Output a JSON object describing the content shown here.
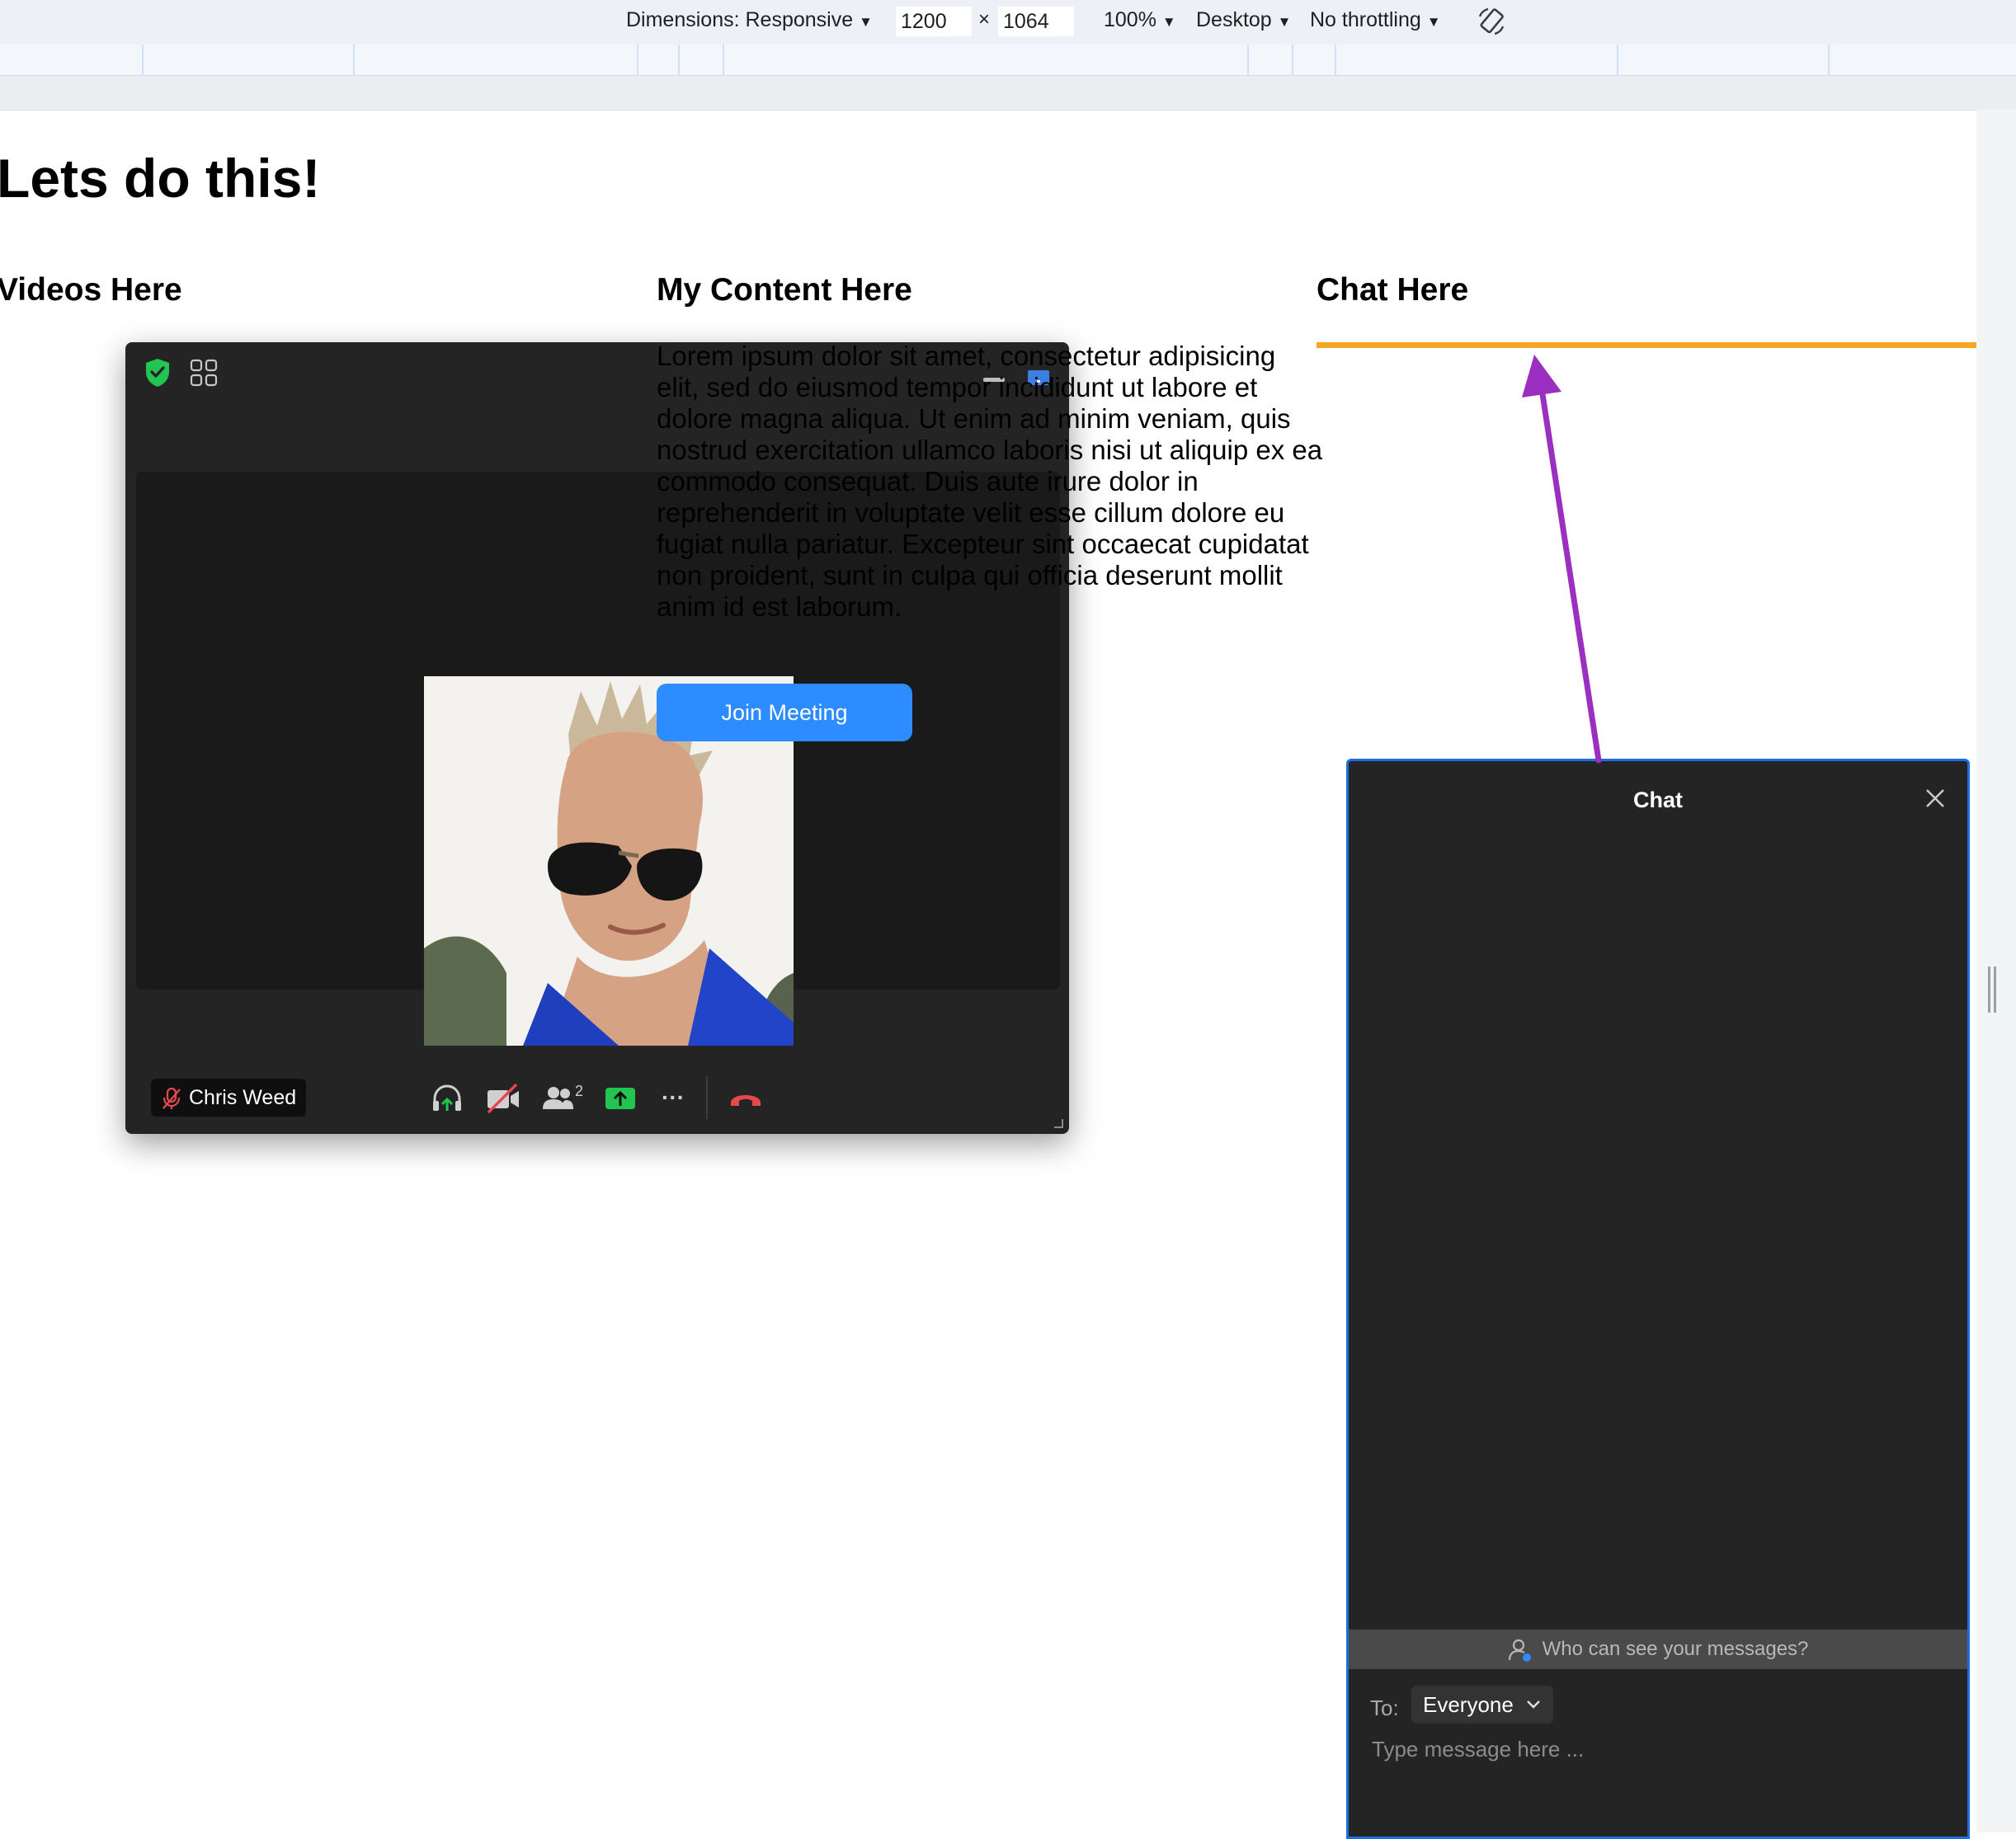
{
  "devtools": {
    "dimensions_label": "Dimensions: Responsive",
    "width_value": "1200",
    "times": "×",
    "height_value": "1064",
    "zoom": "100%",
    "device": "Desktop",
    "throttling": "No throttling",
    "caret": "▼"
  },
  "page": {
    "title": "Lets do this!",
    "col_videos": "Videos Here",
    "col_content": "My Content Here",
    "col_chat": "Chat Here",
    "lorem": "Lorem ipsum dolor sit amet, consectetur adipisicing elit, sed do eiusmod tempor incididunt ut labore et dolore magna aliqua. Ut enim ad minim veniam, quis nostrud exercitation ullamco laboris nisi ut aliquip ex ea commodo consequat. Duis aute irure dolor in reprehenderit in voluptate velit esse cillum dolore eu fugiat nulla pariatur. Excepteur sint occaecat cupidatat non proident, sunt in culpa qui officia deserunt mollit anim id est laborum.",
    "join_button": "Join Meeting",
    "accent_line_color": "#f5a623",
    "arrow_color": "#9b2fbf"
  },
  "video_window": {
    "participant_name": "Chris Weed",
    "participants_count": "2",
    "more_icon": "···",
    "icons": [
      "shield-check-icon",
      "gallery-grid-icon",
      "headphones-icon",
      "video-off-icon",
      "participants-icon",
      "share-screen-icon",
      "more-icon",
      "leave-call-icon"
    ],
    "security_color": "#23c552",
    "share_color": "#23c552",
    "leave_color": "#e5484d"
  },
  "chat": {
    "title": "Chat",
    "who_can_see": "Who can see your messages?",
    "to_label": "To:",
    "recipient": "Everyone",
    "input_placeholder": "Type message here ...",
    "border_color": "#1b6fe0"
  }
}
